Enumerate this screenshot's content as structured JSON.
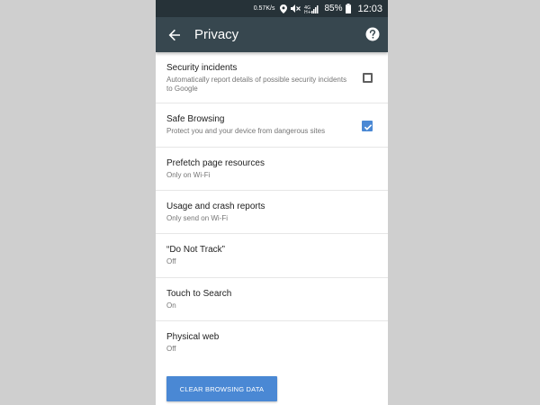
{
  "status_bar": {
    "network_speed": "0.57K/s",
    "battery_percent": "85%",
    "time": "12:03",
    "icons": [
      "location-icon",
      "mute-icon",
      "signal-icon",
      "battery-icon"
    ]
  },
  "toolbar": {
    "title": "Privacy",
    "back_icon": "arrow-left-icon",
    "help_icon": "help-circle-icon",
    "background": "#37474f"
  },
  "settings": [
    {
      "title": "Security incidents",
      "subtitle": "Automatically report details of possible security incidents to Google",
      "checkbox": true,
      "checked": false
    },
    {
      "title": "Safe Browsing",
      "subtitle": "Protect you and your device from dangerous sites",
      "checkbox": true,
      "checked": true
    },
    {
      "title": "Prefetch page resources",
      "subtitle": "Only on Wi-Fi",
      "checkbox": false
    },
    {
      "title": "Usage and crash reports",
      "subtitle": "Only send on Wi-Fi",
      "checkbox": false
    },
    {
      "title": "“Do Not Track”",
      "subtitle": "Off",
      "checkbox": false
    },
    {
      "title": "Touch to Search",
      "subtitle": "On",
      "checkbox": false
    },
    {
      "title": "Physical web",
      "subtitle": "Off",
      "checkbox": false
    }
  ],
  "clear_button": {
    "label": "CLEAR BROWSING DATA",
    "color": "#4a88d4"
  },
  "accent_color": "#4a88d4"
}
